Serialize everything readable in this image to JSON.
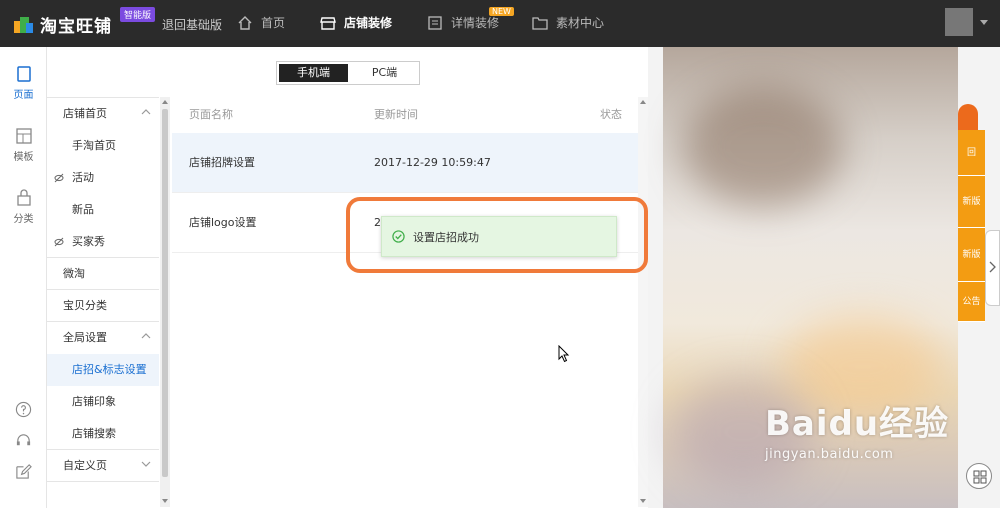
{
  "topbar": {
    "app_name": "淘宝旺铺",
    "edition_badge": "智能版",
    "back_link": "退回基础版",
    "nav": [
      {
        "label": "首页",
        "icon": "home-icon"
      },
      {
        "label": "店铺装修",
        "icon": "store-icon",
        "active": true
      },
      {
        "label": "详情装修",
        "icon": "document-icon",
        "badge": "NEW"
      },
      {
        "label": "素材中心",
        "icon": "folder-icon"
      }
    ]
  },
  "rail": {
    "items": [
      {
        "label": "页面",
        "icon": "page-icon",
        "active": true
      },
      {
        "label": "模板",
        "icon": "template-icon"
      },
      {
        "label": "分类",
        "icon": "bag-icon"
      }
    ],
    "bottom_icons": [
      "help-icon",
      "headset-icon",
      "edit-icon"
    ]
  },
  "device_switch": {
    "mobile": "手机端",
    "pc": "PC端",
    "selected": "mobile"
  },
  "tree": {
    "items": [
      {
        "label": "店铺首页",
        "level": 0,
        "expandable": true
      },
      {
        "label": "手淘首页",
        "level": 1
      },
      {
        "label": "活动",
        "level": 1,
        "hidden": true
      },
      {
        "label": "新品",
        "level": 1
      },
      {
        "label": "买家秀",
        "level": 1,
        "hidden": true
      },
      {
        "label": "微淘",
        "level": 0
      },
      {
        "label": "宝贝分类",
        "level": 0
      },
      {
        "label": "全局设置",
        "level": 0,
        "expandable": true
      },
      {
        "label": "店招&标志设置",
        "level": 1,
        "selected": true
      },
      {
        "label": "店铺印象",
        "level": 1
      },
      {
        "label": "店铺搜索",
        "level": 1
      },
      {
        "label": "自定义页",
        "level": 0,
        "expandable": true
      }
    ]
  },
  "table": {
    "headers": {
      "name": "页面名称",
      "time": "更新时间",
      "status": "状态"
    },
    "rows": [
      {
        "name": "店铺招牌设置",
        "time": "2017-12-29 10:59:47",
        "status": ""
      },
      {
        "name": "店铺logo设置",
        "time": "20",
        "status": ""
      }
    ]
  },
  "toast": {
    "message": "设置店招成功"
  },
  "side_tools": [
    "回",
    "新版",
    "新版",
    "功能",
    "公告"
  ],
  "watermark": {
    "title": "Baidu经验",
    "url": "jingyan.baidu.com"
  },
  "colors": {
    "accent": "#1a6fd1",
    "highlight": "#f07a3a",
    "toast_bg": "#e5f6e2",
    "tool_orange": "#f39c12"
  }
}
